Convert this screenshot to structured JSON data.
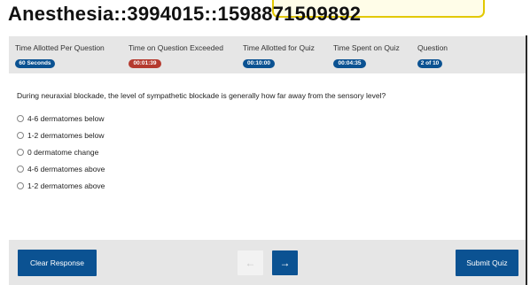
{
  "header": {
    "title": "Anesthesia::3994015::1598871509892"
  },
  "stats": [
    {
      "label": "Time Allotted Per Question",
      "value": "60 Seconds",
      "color": "#0b5292"
    },
    {
      "label": "Time on Question Exceeded",
      "value": "00:01:39",
      "color": "#b53a2f"
    },
    {
      "label": "Time Allotted for Quiz",
      "value": "00:10:00",
      "color": "#0b5292"
    },
    {
      "label": "Time Spent on Quiz",
      "value": "00:04:35",
      "color": "#0b5292"
    },
    {
      "label": "Question",
      "value": "2 of 10",
      "color": "#0b5292"
    }
  ],
  "question": {
    "text": "During neuraxial blockade, the level of sympathetic blockade is generally how far away from the sensory level?",
    "options": [
      "4-6 dermatomes below",
      "1-2 dermatomes below",
      "0 dermatome change",
      "4-6 dermatomes above",
      "1-2 dermatomes above"
    ]
  },
  "footer": {
    "clear_label": "Clear Response",
    "prev_icon": "←",
    "next_icon": "→",
    "submit_label": "Submit Quiz"
  },
  "colors": {
    "primary": "#0b5292",
    "alert": "#b53a2f",
    "panel": "#e6e6e6"
  }
}
